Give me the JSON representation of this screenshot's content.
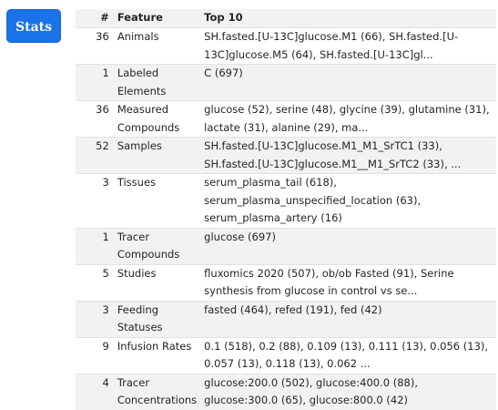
{
  "stats_button": {
    "label": "Stats",
    "color": "#1a73e8"
  },
  "table": {
    "headers": {
      "num": "#",
      "feature": "Feature",
      "top": "Top 10"
    },
    "rows": [
      {
        "num": "36",
        "feature": "Animals",
        "top": "SH.fasted.[U-13C]glucose.M1 (66), SH.fasted.[U-13C]glucose.M5 (64), SH.fasted.[U-13C]gl..."
      },
      {
        "num": "1",
        "feature": "Labeled Elements",
        "top": "C (697)"
      },
      {
        "num": "36",
        "feature": "Measured Compounds",
        "top": "glucose (52), serine (48), glycine (39), glutamine (31), lactate (31), alanine (29), ma..."
      },
      {
        "num": "52",
        "feature": "Samples",
        "top": "SH.fasted.[U-13C]glucose.M1_M1_SrTC1 (33), SH.fasted.[U-13C]glucose.M1__M1_SrTC2 (33), ..."
      },
      {
        "num": "3",
        "feature": "Tissues",
        "top": "serum_plasma_tail (618), serum_plasma_unspecified_location (63), serum_plasma_artery (16)"
      },
      {
        "num": "1",
        "feature": "Tracer Compounds",
        "top": "glucose (697)"
      },
      {
        "num": "5",
        "feature": "Studies",
        "top": "fluxomics 2020 (507), ob/ob Fasted (91), Serine synthesis from glucose in control vs se..."
      },
      {
        "num": "3",
        "feature": "Feeding Statuses",
        "top": "fasted (464), refed (191), fed (42)"
      },
      {
        "num": "9",
        "feature": "Infusion Rates",
        "top": "0.1 (518), 0.2 (88), 0.109 (13), 0.111 (13), 0.056 (13), 0.057 (13), 0.118 (13), 0.062 ..."
      },
      {
        "num": "4",
        "feature": "Tracer Concentrations",
        "top": "glucose:200.0 (502), glucose:400.0 (88), glucose:300.0 (65), glucose:800.0 (42)"
      }
    ]
  }
}
